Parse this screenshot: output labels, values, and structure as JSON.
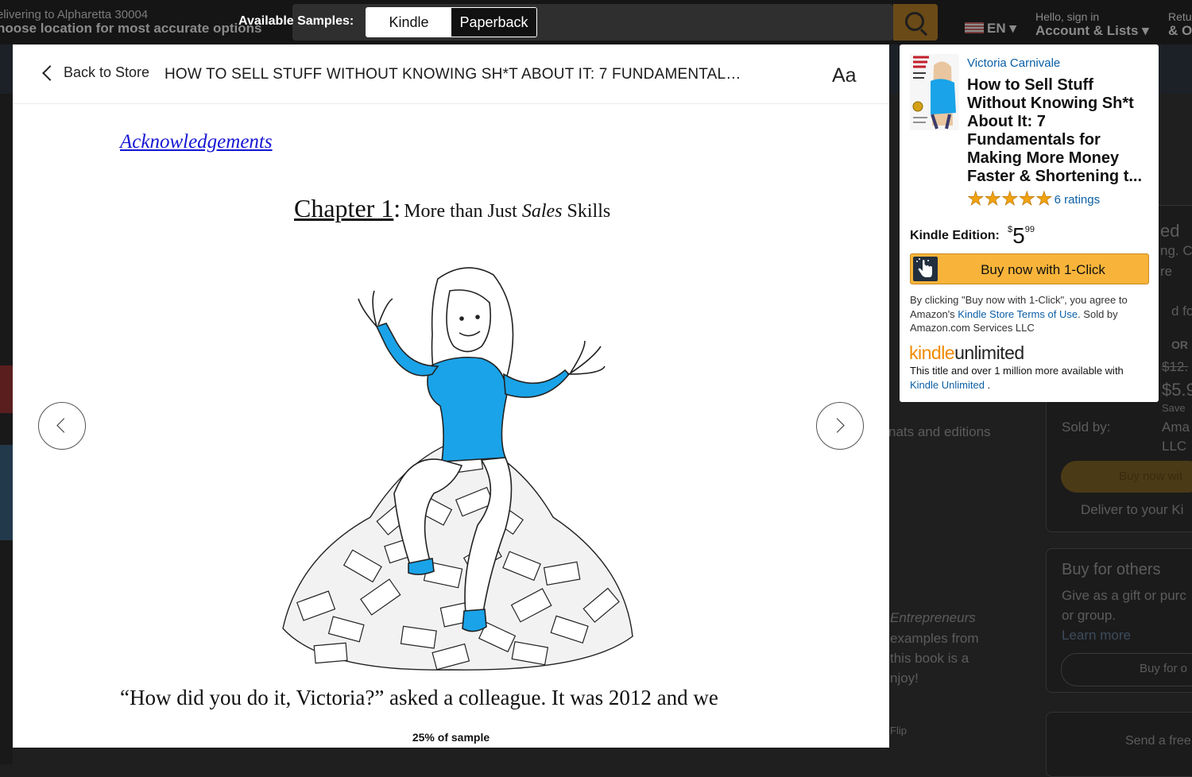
{
  "background": {
    "deliver_line1": "elivering to Alpharetta 30004",
    "deliver_line2": "hoose location for most accurate options",
    "lang": "EN",
    "account_line1": "Hello, sign in",
    "account_line2": "Account & Lists",
    "returns_line1": "Retu",
    "returns_line2": "& O",
    "side_texts": [
      "ed",
      "ng. C",
      "re",
      "d for",
      "OR",
      "$12.",
      "$5.9",
      "Save",
      "Sold by:",
      "Ama",
      "LLC",
      "Buy now wit",
      "Deliver to your Ki",
      "nats and editions",
      "Buy for others",
      "Give as a gift or purc",
      "or group.",
      "Learn more",
      "Buy for o",
      "Entrepreneurs",
      "examples from",
      "this book is a",
      "njoy!",
      "Send a free",
      "Flip"
    ]
  },
  "samples": {
    "label": "Available Samples:",
    "options": [
      "Kindle",
      "Paperback"
    ],
    "active": "Kindle"
  },
  "reader": {
    "back_label": "Back to Store",
    "title": "HOW TO SELL STUFF WITHOUT KNOWING SH*T ABOUT IT: 7 FUNDAMENTALS...",
    "font_button": "Aa",
    "toc_link": "Acknowledgements",
    "chapter_num": "Chapter 1",
    "chapter_colon": ":",
    "chapter_pre": "More than Just ",
    "chapter_em": "Sales",
    "chapter_post": " Skills",
    "body_text": "“How did you do it, Victoria?” asked a colleague. It was 2012 and we",
    "progress": "25% of sample",
    "progress_value": 0.25
  },
  "panel": {
    "author": "Victoria Carnivale",
    "title": "How to Sell Stuff Without Knowing Sh*t About It: 7 Fundamentals for Making More Money Faster & Shortening t...",
    "stars": 5,
    "ratings": "6 ratings",
    "edition_label": "Kindle Edition:",
    "price_currency": "$",
    "price_whole": "5",
    "price_fraction": "99",
    "buy_label": "Buy now with 1-Click",
    "terms_pre": "By clicking \"Buy now with 1-Click\", you agree to Amazon's ",
    "terms_link": "Kindle Store Terms of Use",
    "terms_post": ". Sold by Amazon.com Services LLC",
    "ku_logo_kindle": "kindle",
    "ku_logo_unlimited": "unlimited",
    "ku_text": "This title and over 1 million more available with",
    "ku_link": "Kindle Unlimited",
    "ku_end": " ."
  },
  "colors": {
    "link": "#0b5fa5",
    "buy_button": "#f8b43a",
    "ku_orange": "#f08a00",
    "star": "#f0a210",
    "shirt_blue": "#1aa3e8"
  }
}
